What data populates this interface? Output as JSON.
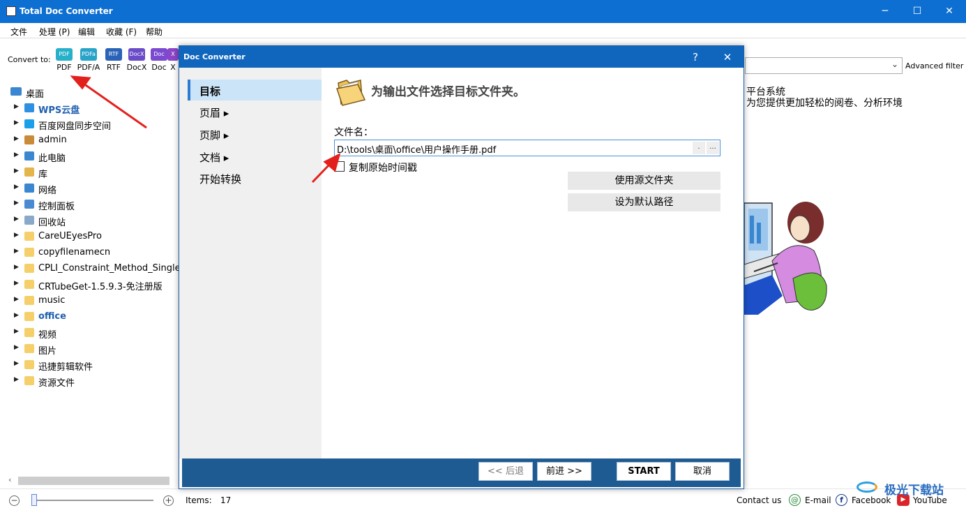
{
  "window": {
    "title": "Total Doc Converter",
    "minimize": "─",
    "maximize": "☐",
    "close": "✕"
  },
  "menu": [
    "文件",
    "处理 (P)",
    "编辑",
    "收藏 (F)",
    "帮助"
  ],
  "toolbar": {
    "convert_to": "Convert to:",
    "formats": [
      {
        "icon": "PDF",
        "label": "PDF",
        "color": "#27b0c9"
      },
      {
        "icon": "PDFa",
        "label": "PDF/A",
        "color": "#2aa3c9"
      },
      {
        "icon": "RTF",
        "label": "RTF",
        "color": "#2a63b8"
      },
      {
        "icon": "DocX",
        "label": "DocX",
        "color": "#6a4bc8"
      },
      {
        "icon": "Doc",
        "label": "Doc",
        "color": "#7b4ad0"
      },
      {
        "icon": "X",
        "label": "X",
        "color": "#8a45c8"
      }
    ],
    "advanced_filter": "Advanced filter"
  },
  "tree": {
    "root": "桌面",
    "items": [
      {
        "name": "WPS云盘",
        "icon": "cloud-icon",
        "color": "#2f8fe0",
        "bold": true
      },
      {
        "name": "百度网盘同步空间",
        "icon": "baidu-drive-icon",
        "color": "#1aa0e8"
      },
      {
        "name": "admin",
        "icon": "user-icon",
        "color": "#c98a3a"
      },
      {
        "name": "此电脑",
        "icon": "computer-icon",
        "color": "#3a86d0"
      },
      {
        "name": "库",
        "icon": "library-icon",
        "color": "#e3b54a"
      },
      {
        "name": "网络",
        "icon": "network-icon",
        "color": "#3a86d0"
      },
      {
        "name": "控制面板",
        "icon": "control-panel-icon",
        "color": "#4a8ad0"
      },
      {
        "name": "回收站",
        "icon": "recycle-bin-icon",
        "color": "#8aa8c8"
      },
      {
        "name": "CareUEyesPro",
        "icon": "folder-icon",
        "color": "#f5cf6a"
      },
      {
        "name": "copyfilenamecn",
        "icon": "folder-icon",
        "color": "#f5cf6a"
      },
      {
        "name": "CPLI_Constraint_Method_SinglePag",
        "icon": "folder-icon",
        "color": "#f5cf6a"
      },
      {
        "name": "CRTubeGet-1.5.9.3-免注册版",
        "icon": "folder-icon",
        "color": "#f5cf6a"
      },
      {
        "name": "music",
        "icon": "folder-icon",
        "color": "#f5cf6a"
      },
      {
        "name": "office",
        "icon": "folder-icon",
        "color": "#f5cf6a",
        "selected": true
      },
      {
        "name": "视频",
        "icon": "folder-icon",
        "color": "#f5cf6a"
      },
      {
        "name": "图片",
        "icon": "folder-icon",
        "color": "#f5cf6a"
      },
      {
        "name": "迅捷剪辑软件",
        "icon": "folder-icon",
        "color": "#f5cf6a"
      },
      {
        "name": "资源文件",
        "icon": "folder-icon",
        "color": "#f5cf6a"
      }
    ]
  },
  "right_pane": {
    "lines": [
      "平台系统",
      "为您提供更加轻松的阅卷、分析环境"
    ]
  },
  "status": {
    "items_label": "Items:",
    "items_count": "17",
    "contact": "Contact us",
    "email": "E-mail",
    "facebook": "Facebook",
    "youtube": "YouTube"
  },
  "dialog": {
    "title": "Doc Converter",
    "help": "?",
    "close": "✕",
    "nav": [
      {
        "label": "目标",
        "active": true
      },
      {
        "label": "页眉 ▸"
      },
      {
        "label": "页脚 ▸"
      },
      {
        "label": "文档 ▸"
      },
      {
        "label": "开始转换"
      }
    ],
    "heading": "为输出文件选择目标文件夹。",
    "filename_label": "文件名：",
    "filename_value": "D:\\tools\\桌面\\office\\用户操作手册.pdf",
    "filename_btn1": ".",
    "filename_btn2": "...",
    "copy_timestamp": "复制原始时间戳",
    "use_source_folder": "使用源文件夹",
    "set_default_path": "设为默认路径",
    "back": "<< 后退",
    "next": "前进 >>",
    "start": "START",
    "cancel": "取消"
  },
  "watermark": "极光下载站"
}
